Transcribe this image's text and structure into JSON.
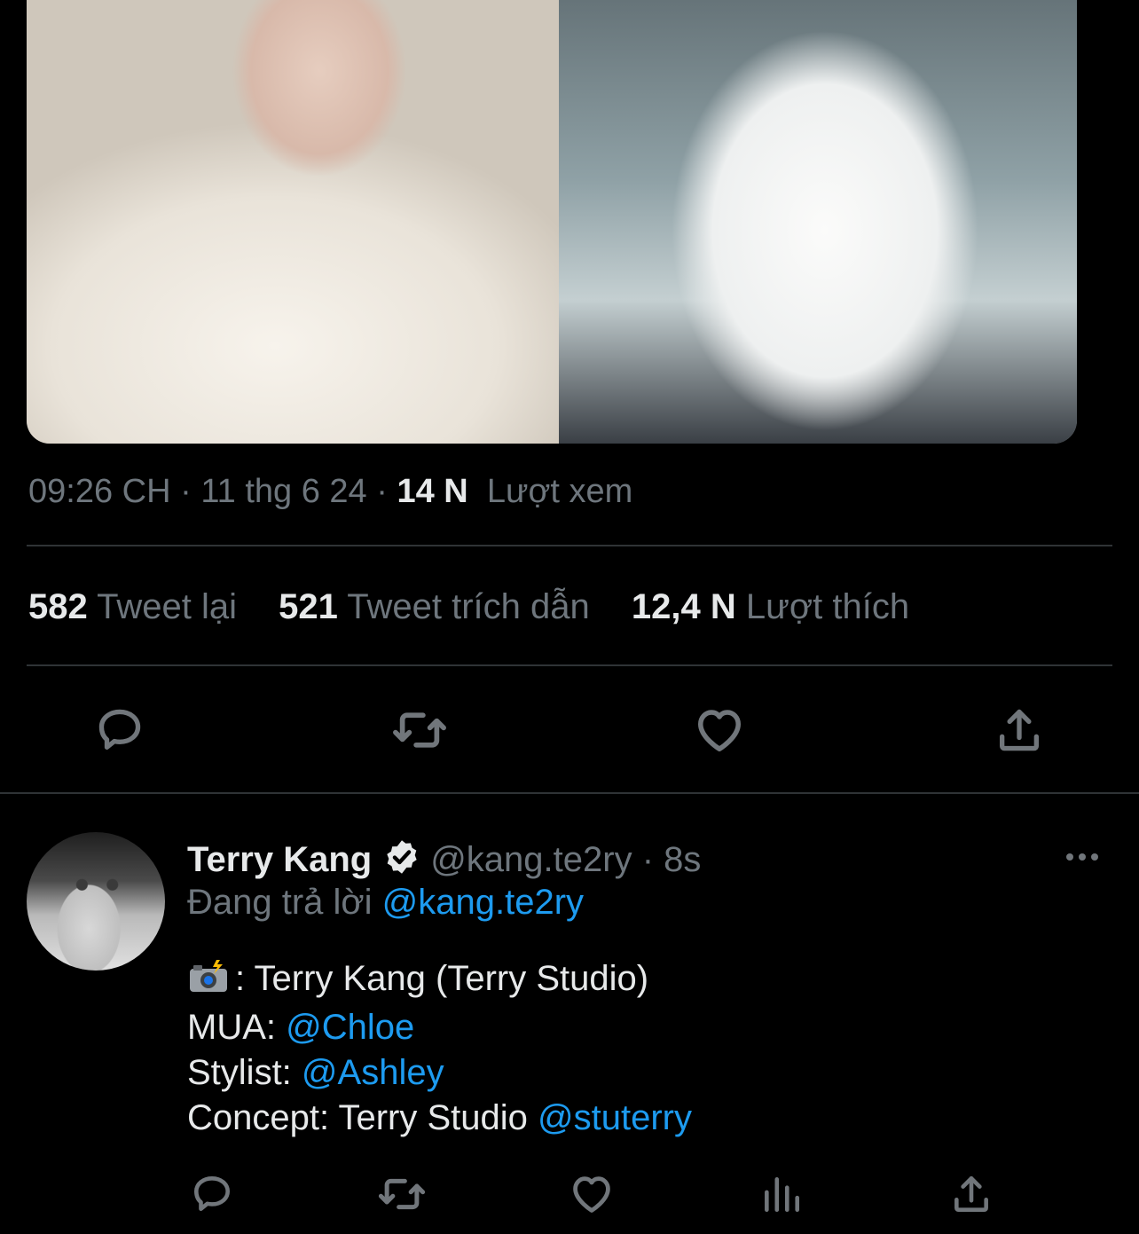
{
  "media": {
    "image_icon": "tweet-photo"
  },
  "meta": {
    "time": "09:26 CH",
    "sep1": " · ",
    "date": "11 thg 6 24",
    "sep2": " · ",
    "views_count": "14 N",
    "views_label": "Lượt xem"
  },
  "stats": {
    "retweets_count": "582",
    "retweets_label": "Tweet lại",
    "quotes_count": "521",
    "quotes_label": "Tweet trích dẫn",
    "likes_count": "12,4 N",
    "likes_label": "Lượt thích"
  },
  "actions": {
    "icons": [
      "reply-icon",
      "retweet-icon",
      "like-icon",
      "share-icon"
    ]
  },
  "reply": {
    "name": "Terry Kang",
    "handle": "@kang.te2ry",
    "dot": " · ",
    "time": "8s",
    "replying_prefix": "Đang trả lời",
    "replying_to": "@kang.te2ry",
    "line1_text": ": Terry Kang (Terry Studio)",
    "line2_label": "MUA:",
    "line2_mention": "@Chloe",
    "line3_label": "Stylist:",
    "line3_mention": "@Ashley",
    "line4_label": "Concept: Terry Studio",
    "line4_mention": "@stuterry",
    "action_icons": [
      "reply-icon",
      "retweet-icon",
      "like-icon",
      "analytics-icon",
      "share-icon"
    ]
  },
  "colors": {
    "background": "#000000",
    "text": "#e7e9ea",
    "muted": "#6e767d",
    "link": "#1d9bf0",
    "divider": "#2f3336"
  }
}
